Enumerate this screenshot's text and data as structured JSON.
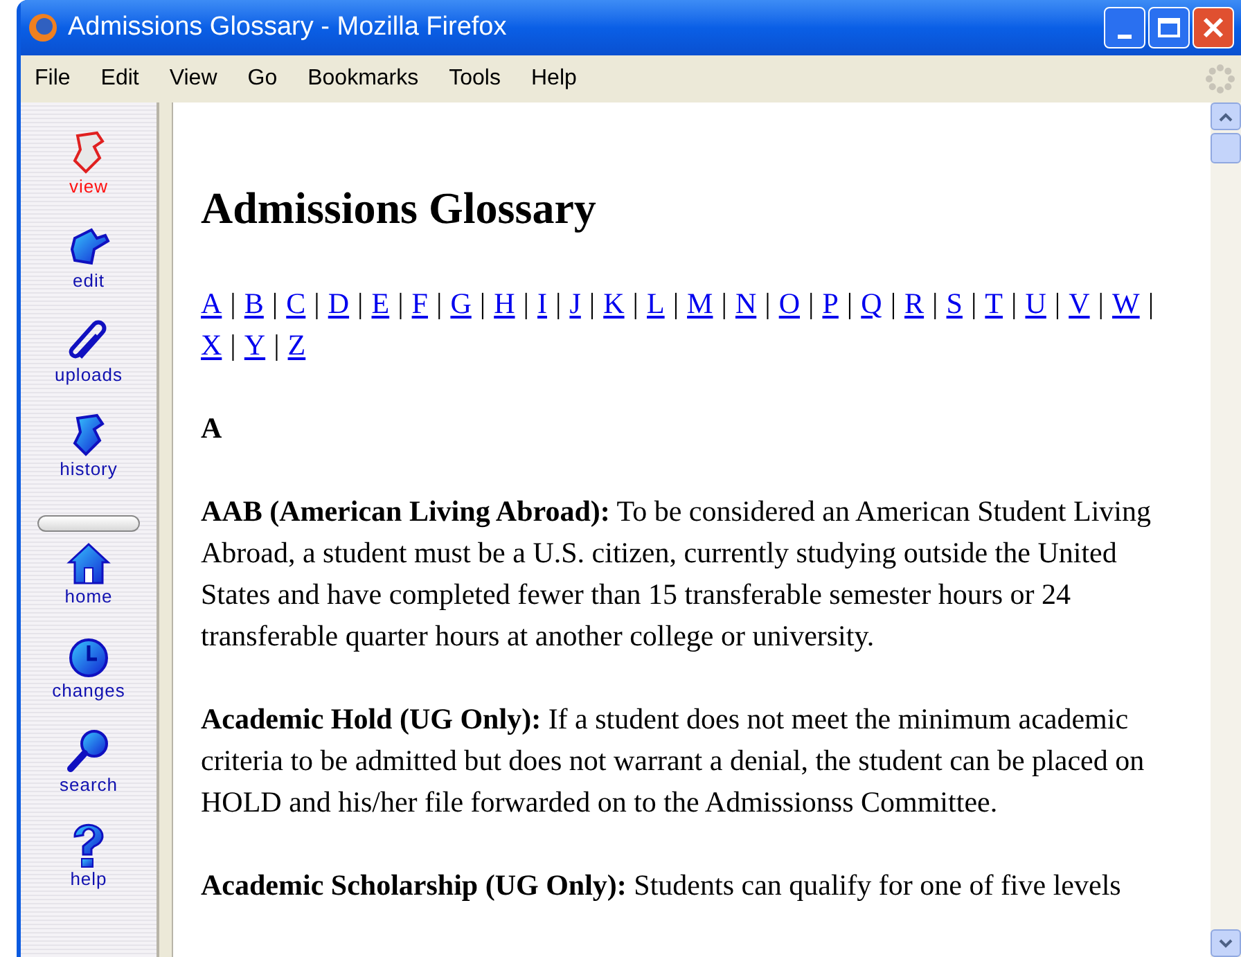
{
  "window": {
    "title": "Admissions Glossary - Mozilla Firefox"
  },
  "menu": [
    "File",
    "Edit",
    "View",
    "Go",
    "Bookmarks",
    "Tools",
    "Help"
  ],
  "sidebar": {
    "groups": [
      [
        {
          "label": "view",
          "selected": true
        },
        {
          "label": "edit",
          "selected": false
        },
        {
          "label": "uploads",
          "selected": false
        },
        {
          "label": "history",
          "selected": false
        }
      ],
      [
        {
          "label": "home",
          "selected": false
        },
        {
          "label": "changes",
          "selected": false
        },
        {
          "label": "search",
          "selected": false
        },
        {
          "label": "help",
          "selected": false
        }
      ]
    ]
  },
  "page": {
    "heading": "Admissions Glossary",
    "letters": [
      "A",
      "B",
      "C",
      "D",
      "E",
      "F",
      "G",
      "H",
      "I",
      "J",
      "K",
      "L",
      "M",
      "N",
      "O",
      "P",
      "Q",
      "R",
      "S",
      "T",
      "U",
      "V",
      "W",
      "X",
      "Y",
      "Z"
    ],
    "separator": "|",
    "section": "A",
    "entries": [
      "**AAB (American Living Abroad):** To be considered an American Student Living Abroad, a student must be a U.S. citizen, currently studying outside the United States and have completed fewer than 15 transferable semester hours or 24 transferable quarter hours at another college or university.",
      "**Academic Hold (UG Only):** If a student does not meet the minimum academic criteria to be admitted but does not warrant a denial, the student can be placed on HOLD and his/her file forwarded on to the Admissionss Committee.",
      "**Academic Scholarship (UG Only):** Students can qualify for one of five levels"
    ]
  }
}
